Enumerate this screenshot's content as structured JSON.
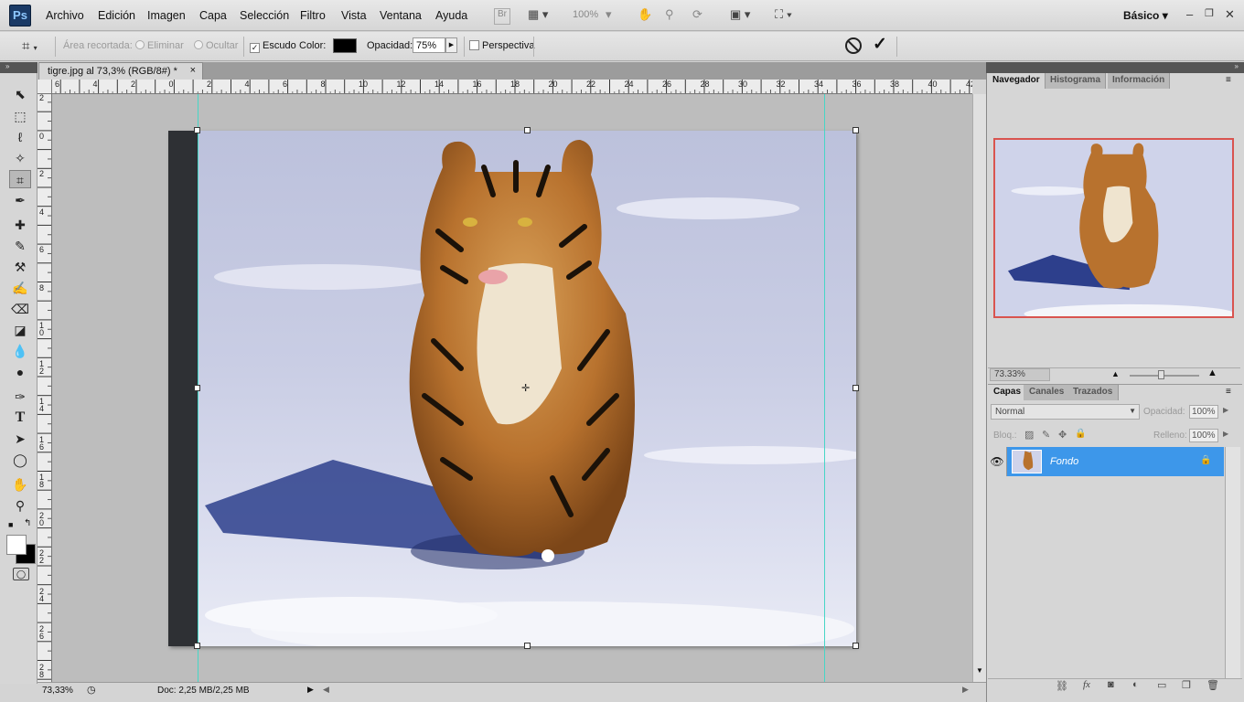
{
  "app": {
    "logo": "Ps"
  },
  "menu": [
    "Archivo",
    "Edición",
    "Imagen",
    "Capa",
    "Selección",
    "Filtro",
    "Vista",
    "Ventana",
    "Ayuda"
  ],
  "menubar_icons": {
    "bridge": "Br",
    "zoom": "100%",
    "workspace": "Básico"
  },
  "options": {
    "area_label": "Área recortada:",
    "delete_label": "Eliminar",
    "hide_label": "Ocultar",
    "shield_label": "Escudo",
    "shield_checked": "✓",
    "color_label": "Color:",
    "color_value": "#000000",
    "opacity_label": "Opacidad:",
    "opacity_value": "75%",
    "perspective_label": "Perspectiva"
  },
  "document": {
    "tab_title": "tigre.jpg al 73,3% (RGB/8#) *",
    "close": "×"
  },
  "rulers": {
    "horizontal": [
      "6",
      "4",
      "2",
      "0",
      "2",
      "4",
      "6",
      "8",
      "10",
      "12",
      "14",
      "16",
      "18",
      "20",
      "22",
      "24",
      "26",
      "28",
      "30",
      "32",
      "34",
      "36",
      "38",
      "40",
      "42"
    ],
    "vertical": [
      "2",
      "0",
      "2",
      "4",
      "6",
      "8",
      "1 0",
      "1 2",
      "1 4",
      "1 6",
      "1 8",
      "2 0",
      "2 2",
      "2 4",
      "2 6",
      "2 8"
    ]
  },
  "status": {
    "zoom": "73,33%",
    "doc": "Doc: 2,25 MB/2,25 MB"
  },
  "navigator": {
    "tabs": [
      "Navegador",
      "Histograma",
      "Información"
    ],
    "zoom": "73.33%"
  },
  "layers": {
    "tabs": [
      "Capas",
      "Canales",
      "Trazados"
    ],
    "blend_mode": "Normal",
    "opacity_label": "Opacidad:",
    "opacity_value": "100%",
    "lock_label": "Bloq.:",
    "fill_label": "Relleno:",
    "fill_value": "100%",
    "items": [
      {
        "name": "Fondo"
      }
    ]
  },
  "colors": {
    "accent": "#3d97ea",
    "guide": "#47d6c6",
    "nav_frame": "#d9544f"
  }
}
